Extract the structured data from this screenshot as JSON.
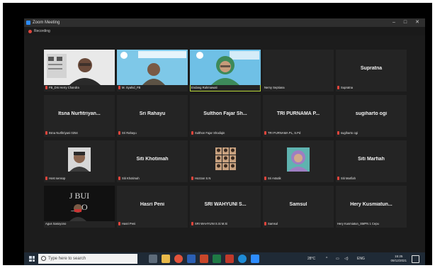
{
  "window": {
    "title": "Zoom Meeting",
    "minimize": "–",
    "maximize": "□",
    "close": "✕"
  },
  "recording": {
    "label": "Recording"
  },
  "participants": [
    {
      "big": "",
      "plate": "FB_Drs Herry Chandra",
      "mic_muted": true,
      "kind": "video-person"
    },
    {
      "big": "",
      "plate": "M. Syahid_FB",
      "mic_muted": true,
      "kind": "video-slide"
    },
    {
      "big": "",
      "plate": "Endang Rahmawati",
      "mic_muted": false,
      "kind": "video-woman",
      "speaking": true
    },
    {
      "big": "",
      "plate": "Nemy Septiana",
      "mic_muted": false,
      "kind": "blank"
    },
    {
      "big": "Supratna",
      "plate": "Supratna",
      "mic_muted": true,
      "kind": "name"
    },
    {
      "big": "Itsna Nurfitriyan...",
      "plate": "Itsna Nurfitriyani 0254",
      "mic_muted": true,
      "kind": "name"
    },
    {
      "big": "Sri Rahayu",
      "plate": "Sri Rahayu",
      "mic_muted": true,
      "kind": "name"
    },
    {
      "big": "Sulthon Fajar Sh...",
      "plate": "Sulthon Fajar Shodiqin",
      "mic_muted": true,
      "kind": "name"
    },
    {
      "big": "TRI PURNAMA P...",
      "plate": "TRI PURNAMA PL, S.Pd",
      "mic_muted": true,
      "kind": "name"
    },
    {
      "big": "sugiharto ogi",
      "plate": "sugiharto ogi",
      "mic_muted": true,
      "kind": "name"
    },
    {
      "big": "",
      "plate": "Host sensop",
      "mic_muted": true,
      "kind": "avatar-man"
    },
    {
      "big": "Siti Khotimah",
      "plate": "Siti Khotimah",
      "mic_muted": true,
      "kind": "name"
    },
    {
      "big": "",
      "plate": "Hozzan S.N",
      "mic_muted": true,
      "kind": "avatar-grid"
    },
    {
      "big": "",
      "plate": "Sri Astutik",
      "mic_muted": true,
      "kind": "avatar-hijab"
    },
    {
      "big": "Siti Marfiah",
      "plate": "Siti Marfiah",
      "mic_muted": true,
      "kind": "name"
    },
    {
      "big": "",
      "plate": "Agus Sasoyono",
      "mic_muted": false,
      "kind": "video-dark"
    },
    {
      "big": "Hasri Peni",
      "plate": "Hasri Peni",
      "mic_muted": true,
      "kind": "name"
    },
    {
      "big": "SRI WAHYUNI S...",
      "plate": "SRI WAHYUNI S.Si M.Si",
      "mic_muted": true,
      "kind": "name"
    },
    {
      "big": "Samsul",
      "plate": "Samsul",
      "mic_muted": true,
      "kind": "name"
    },
    {
      "big": "Hery Kusmiatun...",
      "plate": "Hery Kusmiatun_SMPN 1 Cepu",
      "mic_muted": false,
      "kind": "name"
    }
  ],
  "taskbar": {
    "search_placeholder": "Type here to search",
    "weather": "28°C",
    "language": "ENG",
    "time": "15:25",
    "date": "09/12/2021"
  },
  "colors": {
    "speaking_border": "#b8d73a",
    "mic_muted": "#e0453c",
    "tile_bg": "#242424"
  }
}
